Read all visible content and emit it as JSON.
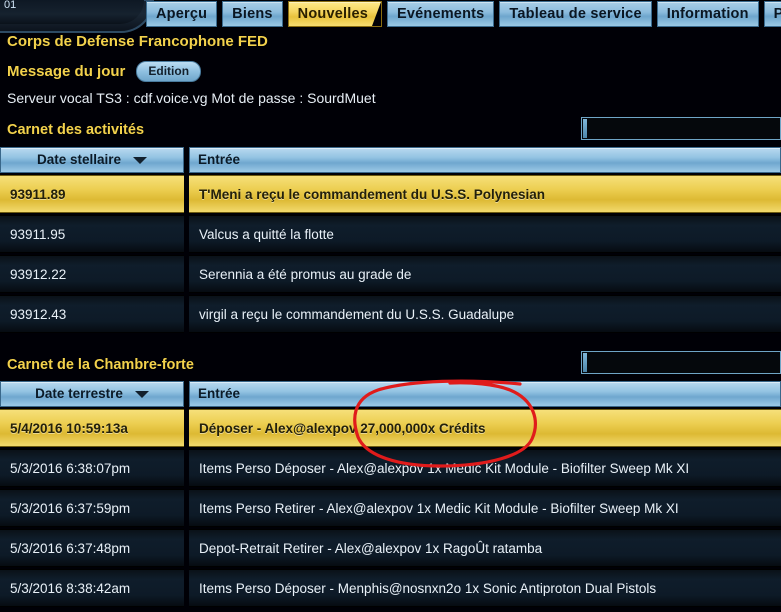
{
  "window": {
    "corner_number": "01"
  },
  "tabs": [
    {
      "label": "Aperçu",
      "active": false
    },
    {
      "label": "Biens",
      "active": false
    },
    {
      "label": "Nouvelles",
      "active": true
    },
    {
      "label": "Evénements",
      "active": false
    },
    {
      "label": "Tableau de service",
      "active": false
    },
    {
      "label": "Information",
      "active": false
    },
    {
      "label": "Param",
      "active": false
    }
  ],
  "header": {
    "fleet_name": "Corps de Defense Francophone FED",
    "motd_label": "Message du jour",
    "edit_button": "Edition",
    "server_line": "Serveur vocal TS3 : cdf.voice.vg  Mot de passe : SourdMuet"
  },
  "activity_log": {
    "title": "Carnet des activités",
    "search_value": "",
    "search_placeholder": "",
    "columns": {
      "date": "Date stellaire",
      "entry": "Entrée"
    },
    "sort_icon": "chevron-down-icon",
    "rows": [
      {
        "date": "93911.89",
        "entry": "T'Meni a reçu le commandement du U.S.S. Polynesian",
        "selected": true
      },
      {
        "date": "93911.95",
        "entry": "Valcus  a quitté la flotte",
        "selected": false
      },
      {
        "date": "93912.22",
        "entry": "Serennia a été promus au grade de",
        "selected": false
      },
      {
        "date": "93912.43",
        "entry": "virgil a reçu le commandement du U.S.S. Guadalupe",
        "selected": false
      }
    ]
  },
  "vault_log": {
    "title": "Carnet de la Chambre-forte",
    "search_value": "",
    "search_placeholder": "",
    "columns": {
      "date": "Date terrestre",
      "entry": "Entrée"
    },
    "sort_icon": "chevron-down-icon",
    "rows": [
      {
        "date": "5/4/2016 10:59:13a",
        "entry": "Déposer - Alex@alexpov 27,000,000x Crédits",
        "selected": true
      },
      {
        "date": "5/3/2016 6:38:07pm",
        "entry": "Items Perso Déposer - Alex@alexpov 1x Medic Kit Module - Biofilter Sweep Mk XI",
        "selected": false
      },
      {
        "date": "5/3/2016 6:37:59pm",
        "entry": "Items Perso Retirer - Alex@alexpov 1x Medic Kit Module - Biofilter Sweep Mk XI",
        "selected": false
      },
      {
        "date": "5/3/2016 6:37:48pm",
        "entry": "Depot-Retrait Retirer - Alex@alexpov 1x RagoÛt ratamba",
        "selected": false
      },
      {
        "date": "5/3/2016 8:38:42am",
        "entry": "Items Perso Déposer - Menphis@nosnxn2o 1x Sonic Antiproton Dual Pistols",
        "selected": false
      }
    ]
  },
  "annotation": {
    "shape": "ellipse",
    "color": "#e01b1b",
    "target": "27,000,000x Crédits"
  },
  "colors": {
    "accent_yellow": "#f3d24c",
    "tab_blue": "#8cbcdd",
    "selected_row": "#ecce50",
    "background": "#000006",
    "annotation_red": "#e01b1b"
  }
}
